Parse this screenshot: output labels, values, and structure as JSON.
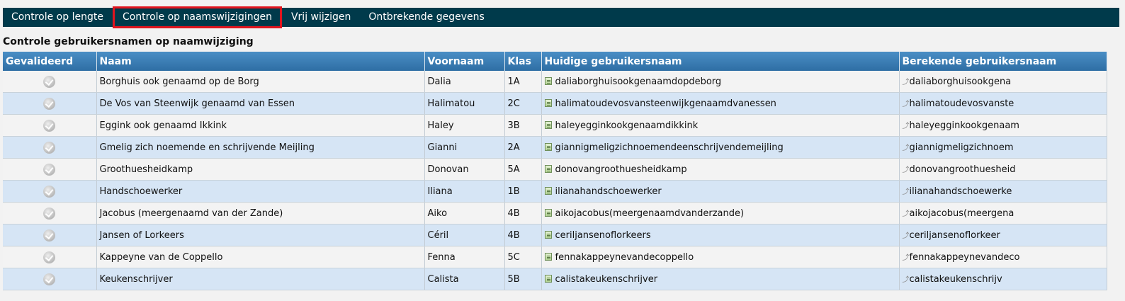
{
  "nav": {
    "items": [
      {
        "label": "Controle op lengte",
        "active": false
      },
      {
        "label": "Controle op naamswijzigingen",
        "active": true
      },
      {
        "label": "Vrij wijzigen",
        "active": false
      },
      {
        "label": "Ontbrekende gegevens",
        "active": false
      }
    ]
  },
  "section_title": "Controle gebruikersnamen op naamwijziging",
  "table": {
    "columns": [
      "Gevalideerd",
      "Naam",
      "Voornaam",
      "Klas",
      "Huidige gebruikersnaam",
      "Berekende gebruikersnaam"
    ],
    "rows": [
      {
        "naam": "Borghuis ook genaamd op de Borg",
        "voornaam": "Dalia",
        "klas": "1A",
        "huidige": "daliaborghuisookgenaamdopdeborg",
        "berekende": "daliaborghuisookgena"
      },
      {
        "naam": "De Vos van Steenwijk genaamd van Essen",
        "voornaam": "Halimatou",
        "klas": "2C",
        "huidige": "halimatoudevosvansteenwijkgenaamdvanessen",
        "berekende": "halimatoudevosvanste"
      },
      {
        "naam": "Eggink ook genaamd Ikkink",
        "voornaam": "Haley",
        "klas": "3B",
        "huidige": "haleyegginkookgenaamdikkink",
        "berekende": "haleyegginkookgenaam"
      },
      {
        "naam": "Gmelig zich noemende en schrijvende Meijling",
        "voornaam": "Gianni",
        "klas": "2A",
        "huidige": "giannigmeligzichnoemendeenschrijvendemeijling",
        "berekende": "giannigmeligzichnoem"
      },
      {
        "naam": "Groothuesheidkamp",
        "voornaam": "Donovan",
        "klas": "5A",
        "huidige": "donovangroothuesheidkamp",
        "berekende": "donovangroothuesheid"
      },
      {
        "naam": "Handschoewerker",
        "voornaam": "Iliana",
        "klas": "1B",
        "huidige": "ilianahandschoewerker",
        "berekende": "ilianahandschoewerke"
      },
      {
        "naam": "Jacobus (meergenaamd van der Zande)",
        "voornaam": "Aiko",
        "klas": "4B",
        "huidige": "aikojacobus(meergenaamdvanderzande)",
        "berekende": "aikojacobus(meergena"
      },
      {
        "naam": "Jansen of Lorkeers",
        "voornaam": "Céril",
        "klas": "4B",
        "huidige": "ceriljansenoflorkeers",
        "berekende": "ceriljansenoflorkeer"
      },
      {
        "naam": "Kappeyne van de Coppello",
        "voornaam": "Fenna",
        "klas": "5C",
        "huidige": "fennakappeynevandecoppello",
        "berekende": "fennakappeynevandeco"
      },
      {
        "naam": "Keukenschrijver",
        "voornaam": "Calista",
        "klas": "5B",
        "huidige": "calistakeukenschrijver",
        "berekende": "calistakeukenschrijv"
      }
    ]
  },
  "icons": {
    "validated": "check-circle-icon",
    "current_username": "note-icon",
    "calculated_username": "calculate-icon"
  }
}
